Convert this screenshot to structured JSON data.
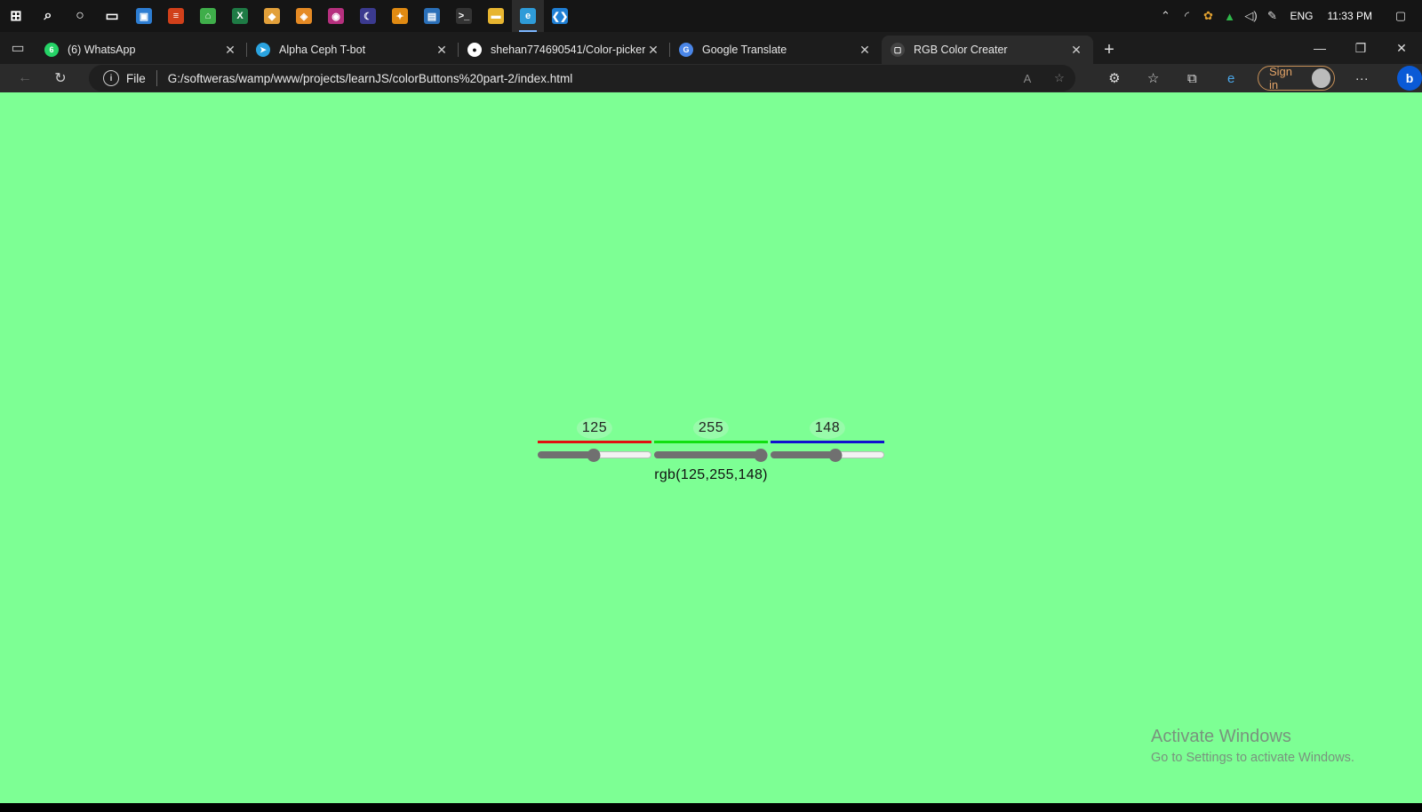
{
  "taskbar": {
    "icons": [
      {
        "name": "windows-start-icon",
        "color": "#ffffff",
        "glyph": "⊞"
      },
      {
        "name": "search-icon",
        "color": "#ffffff",
        "glyph": "⌕"
      },
      {
        "name": "cortana-icon",
        "color": "#ffffff",
        "glyph": "○"
      },
      {
        "name": "task-view-icon",
        "color": "#ffffff",
        "glyph": "▭"
      },
      {
        "name": "app-icon-1",
        "color": "#2d7dd2",
        "glyph": "▣"
      },
      {
        "name": "app-icon-2",
        "color": "#d1401a",
        "glyph": "≡"
      },
      {
        "name": "app-icon-3",
        "color": "#3fae4a",
        "glyph": "⌂"
      },
      {
        "name": "excel-icon",
        "color": "#1e7b45",
        "glyph": "X"
      },
      {
        "name": "git-icon",
        "color": "#e2a03a",
        "glyph": "◆"
      },
      {
        "name": "app-icon-4",
        "color": "#e58a24",
        "glyph": "◈"
      },
      {
        "name": "app-icon-5",
        "color": "#b6307e",
        "glyph": "◉"
      },
      {
        "name": "eclipse-icon",
        "color": "#3b3a8f",
        "glyph": "☾"
      },
      {
        "name": "app-icon-6",
        "color": "#e08a12",
        "glyph": "✦"
      },
      {
        "name": "app-icon-7",
        "color": "#2a6fb8",
        "glyph": "▤"
      },
      {
        "name": "terminal-icon",
        "color": "#333333",
        "glyph": ">_"
      },
      {
        "name": "file-explorer-icon",
        "color": "#e7b530",
        "glyph": "▬"
      },
      {
        "name": "edge-icon",
        "color": "#2e9bd8",
        "glyph": "e"
      },
      {
        "name": "vscode-icon",
        "color": "#1f7fd4",
        "glyph": "❮❯"
      }
    ],
    "tray": {
      "lang": "ENG",
      "time": "11:33 PM"
    }
  },
  "tabs": [
    {
      "title": "(6) WhatsApp",
      "fav_color": "#25d366",
      "fav_glyph": "6"
    },
    {
      "title": "Alpha Ceph T-bot",
      "fav_color": "#2aa3df",
      "fav_glyph": "➤"
    },
    {
      "title": "shehan774690541/Color-picker-",
      "fav_color": "#ffffff",
      "fav_glyph": "●"
    },
    {
      "title": "Google Translate",
      "fav_color": "#4a86e8",
      "fav_glyph": "G"
    },
    {
      "title": "RGB Color Creater",
      "fav_color": "#444444",
      "fav_glyph": "▢"
    }
  ],
  "address": {
    "file_label": "File",
    "url": "G:/softweras/wamp/www/projects/learnJS/colorButtons%20part-2/index.html"
  },
  "toolbar": {
    "signin_label": "Sign in"
  },
  "page": {
    "background": "#7dff94",
    "channels": [
      {
        "name": "red",
        "value": "125",
        "line_color": "#e01010",
        "level": 0.49
      },
      {
        "name": "green",
        "value": "255",
        "line_color": "#10e010",
        "level": 1.0
      },
      {
        "name": "blue",
        "value": "148",
        "line_color": "#1010d0",
        "level": 0.58
      }
    ],
    "rgb_text": "rgb(125,255,148)"
  },
  "watermark": {
    "line1": "Activate Windows",
    "line2": "Go to Settings to activate Windows."
  }
}
